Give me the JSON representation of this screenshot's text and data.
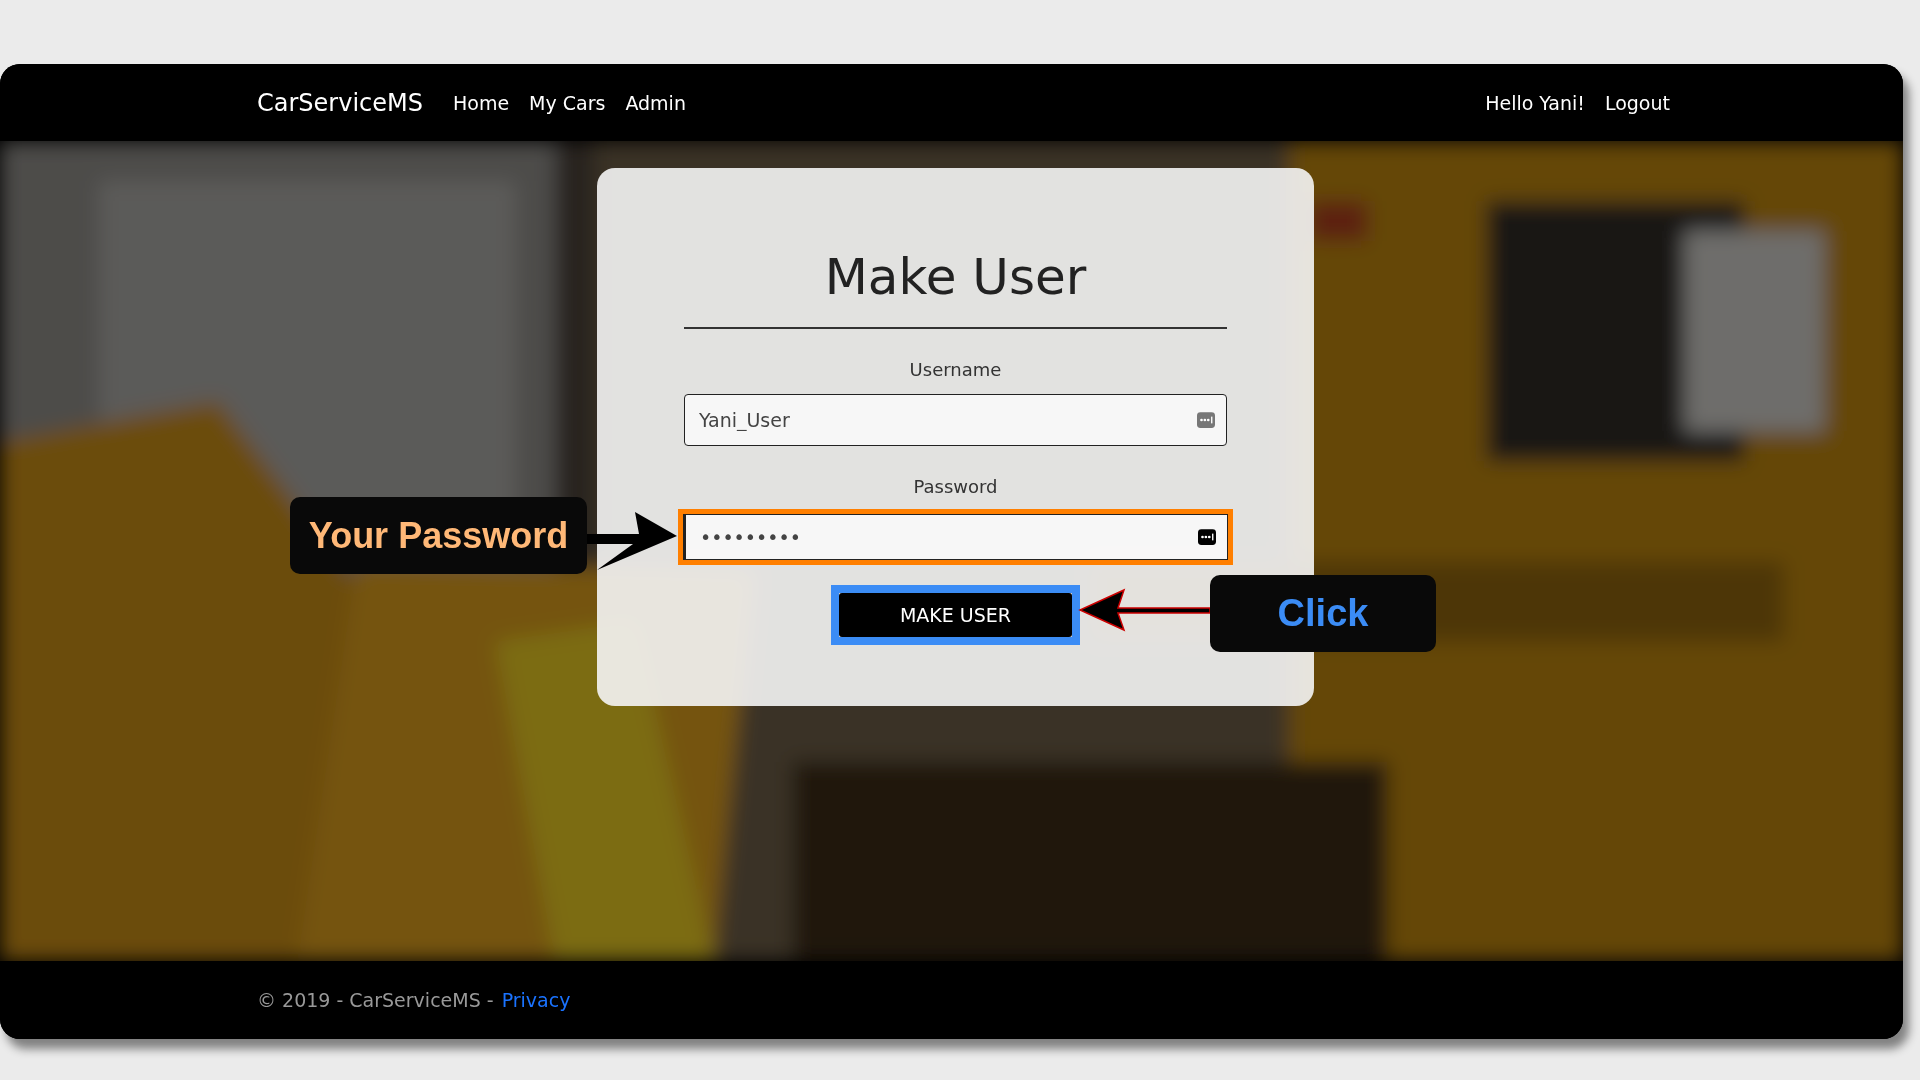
{
  "navbar": {
    "brand": "CarServiceMS",
    "links": [
      {
        "label": "Home"
      },
      {
        "label": "My Cars"
      },
      {
        "label": "Admin"
      }
    ],
    "greeting": "Hello Yani!",
    "logout": "Logout"
  },
  "form": {
    "title": "Make User",
    "fields": [
      {
        "label": "Username",
        "value": "Yani_User",
        "highlighted": false
      },
      {
        "label": "Password",
        "value": "•••••••••",
        "highlighted": true
      }
    ],
    "submit": {
      "label": "MAKE USER",
      "highlighted": true
    }
  },
  "callouts": [
    {
      "text": "Your Password",
      "color": "#ffb877"
    },
    {
      "text": "Click",
      "color": "#3b8cf5"
    }
  ],
  "footer": {
    "copyright": "© 2019 - CarServiceMS -",
    "link": "Privacy"
  }
}
